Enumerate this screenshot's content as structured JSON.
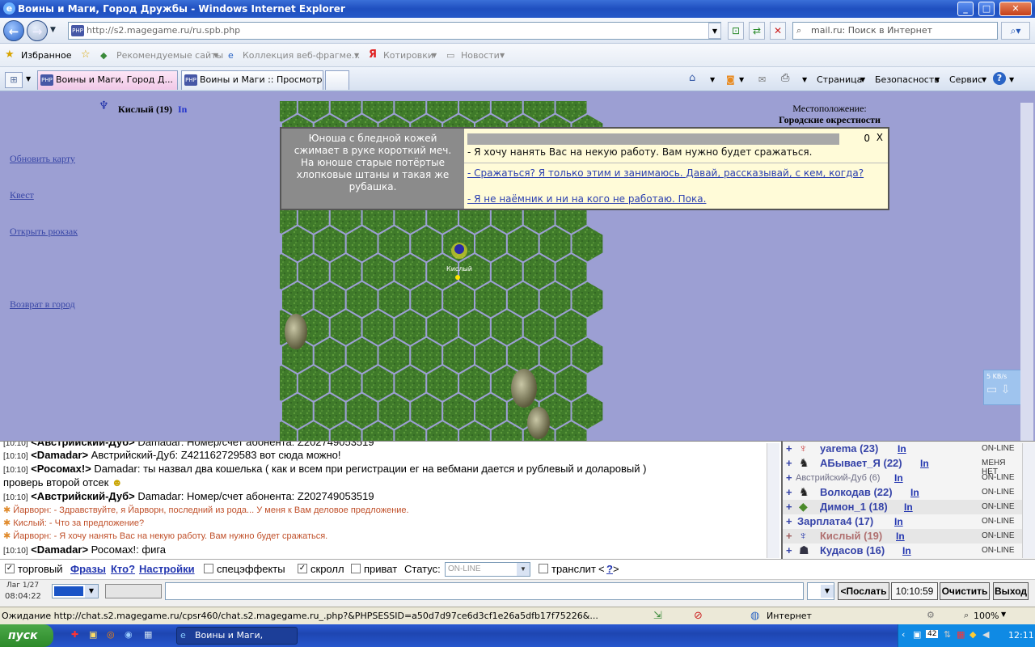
{
  "window": {
    "title": "Воины и Маги, Город Дружбы - Windows Internet Explorer",
    "min": "_",
    "max": "□",
    "close": "✕"
  },
  "address": {
    "url": "http://s2.magegame.ru/ru.spb.php",
    "search_placeholder": "mail.ru: Поиск в Интернет"
  },
  "favorites": {
    "favorites_label": "Избранное",
    "items": [
      "Рекомендуемые сайты",
      "Коллекция веб-фрагме...",
      "Котировки",
      "Новости"
    ]
  },
  "tabs": [
    {
      "label": "Воины и Маги, Город Д..."
    },
    {
      "label": "Воины и Маги :: Просмотр т..."
    }
  ],
  "commands": {
    "page": "Страница",
    "security": "Безопасность",
    "service": "Сервис"
  },
  "player": {
    "name": "Кислый (19)",
    "info": "In"
  },
  "sidebar": {
    "links": [
      "Обновить карту",
      "Квест",
      "Открыть рюкзак",
      "Возврат в город"
    ]
  },
  "location": {
    "label": "Местоположение:",
    "value": "Городские окрестности"
  },
  "map_token": {
    "name": "Кислый"
  },
  "npc_dialog": {
    "description": "Юноша с бледной кожей сжимает в руке короткий меч. На юноше старые потёртые хлопковые штаны и такая же рубашка.",
    "counter": "0",
    "close": "X",
    "question": "- Я хочу нанять Вас на некую работу. Вам нужно будет сражаться.",
    "answers": [
      "- Сражаться? Я только этим и занимаюсь. Давай, рассказывай, с кем, когда?",
      "- Я не наёмник и ни на кого не работаю. Пока."
    ]
  },
  "net_meter": {
    "speed": "5 KB/s"
  },
  "chat": {
    "lines": [
      {
        "time": "[10:10]",
        "nick": "<Австрийский-Дуб>",
        "text": "Damadar: Номер/счет абонента: Z202749053519"
      },
      {
        "time": "[10:10]",
        "nick": "<Damadar>",
        "text": "Австрийский-Дуб: Z421162729583 вот сюда можно!"
      },
      {
        "time": "[10:10]",
        "nick": "<Росомах!>",
        "text": "Damadar: ты назвал два кошелька ( как и всем при регистрации ег на вебмани дается и рублевый и доларовый )"
      },
      {
        "time": "",
        "nick": "",
        "text": "проверь второй отсек"
      },
      {
        "time": "[10:10]",
        "nick": "<Австрийский-Дуб>",
        "text": "Damadar: Номер/счет абонента: Z202749053519"
      },
      {
        "time": "",
        "nick": "",
        "text": "Йарворн: - Здравствуйте, я Йарворн, последний из рода... У меня к Вам деловое предложение."
      },
      {
        "time": "",
        "nick": "",
        "text": "Кислый: - Что за предложение?"
      },
      {
        "time": "",
        "nick": "",
        "text": "Йарворн: - Я хочу нанять Вас на некую работу. Вам нужно будет сражаться."
      },
      {
        "time": "[10:10]",
        "nick": "<Damadar>",
        "text": "Росомах!: фига"
      }
    ]
  },
  "users": [
    {
      "name": "yarema (23)",
      "info": "In",
      "status": "ON-LINE"
    },
    {
      "name": "АБывает_Я (22)",
      "info": "In",
      "status": "МЕНЯ НЕТ"
    },
    {
      "name": "Австрийский-Дуб (6)",
      "info": "In",
      "status": "ON-LINE"
    },
    {
      "name": "Волкодав (22)",
      "info": "In",
      "status": "ON-LINE"
    },
    {
      "name": "Димон_1 (18)",
      "info": "In",
      "status": "ON-LINE"
    },
    {
      "name": "Зарплата4 (17)",
      "info": "In",
      "status": "ON-LINE"
    },
    {
      "name": "Кислый (19)",
      "info": "In",
      "status": "ON-LINE"
    },
    {
      "name": "Кудасов (16)",
      "info": "In",
      "status": "ON-LINE"
    }
  ],
  "chat_options": {
    "trade": "торговый",
    "phrases": "Фразы",
    "who": "Кто?",
    "settings": "Настройки",
    "effects": "спецэффекты",
    "scroll": "скролл",
    "private": "приват",
    "status_label": "Статус:",
    "status_value": "ON-LINE",
    "translit": "транслит",
    "translit_help": "?"
  },
  "input_row": {
    "lag": "Лаг 1/27",
    "time": "08:04:22",
    "send": "<Послать",
    "clock": "10:10:59",
    "clear": "Очистить",
    "exit": "Выход"
  },
  "statusbar": {
    "text": "Ожидание http://chat.s2.magegame.ru/cpsr460/chat.s2.magegame.ru_.php?&PHPSESSID=a50d7d97ce6d3cf1e26a5dfb17f75226&...",
    "zone": "Интернет",
    "zoom": "100%"
  },
  "taskbar": {
    "start": "пуск",
    "item": "Воины и Маги, Город...",
    "clock": "12:11",
    "badge": "42"
  }
}
